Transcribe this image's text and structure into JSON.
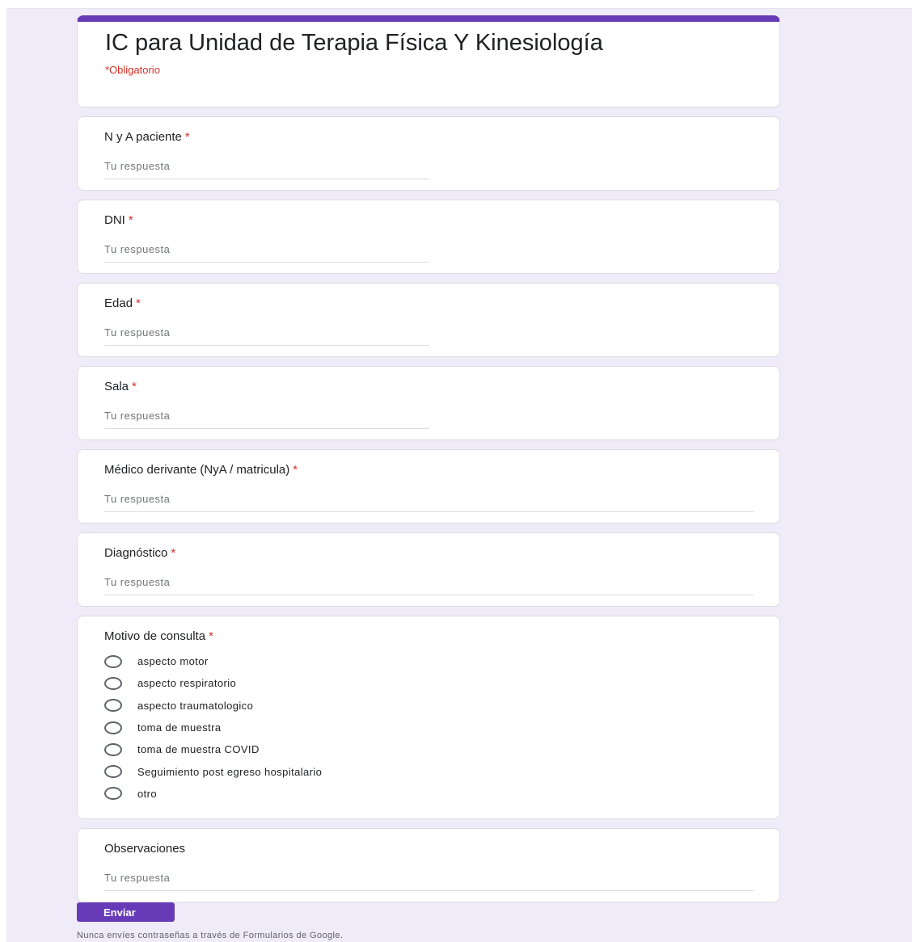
{
  "form": {
    "title": "IC para Unidad de Terapia Física Y Kinesiología",
    "required_note": "*Obligatorio",
    "required_marker": "*",
    "answer_placeholder": "Tu respuesta"
  },
  "questions": [
    {
      "label": "N y A paciente",
      "required": true
    },
    {
      "label": "DNI",
      "required": true
    },
    {
      "label": "Edad",
      "required": true
    },
    {
      "label": "Sala",
      "required": true
    },
    {
      "label": "Médico derivante (NyA / matricula)",
      "required": true
    },
    {
      "label": "Diagnóstico",
      "required": true
    }
  ],
  "motivo": {
    "label": "Motivo de consulta",
    "required": true,
    "options": [
      "aspecto motor",
      "aspecto respiratorio",
      "aspecto traumatologico",
      "toma de muestra",
      "toma de muestra COVID",
      "Seguimiento post egreso hospitalario",
      "otro"
    ]
  },
  "observaciones": {
    "label": "Observaciones"
  },
  "submit": {
    "label": "Enviar"
  },
  "footer": {
    "note": "Nunca envíes contraseñas a través de Formularios de Google."
  },
  "colors": {
    "accent": "#673ab7",
    "required": "#d93025",
    "background": "#f0ebf8"
  }
}
